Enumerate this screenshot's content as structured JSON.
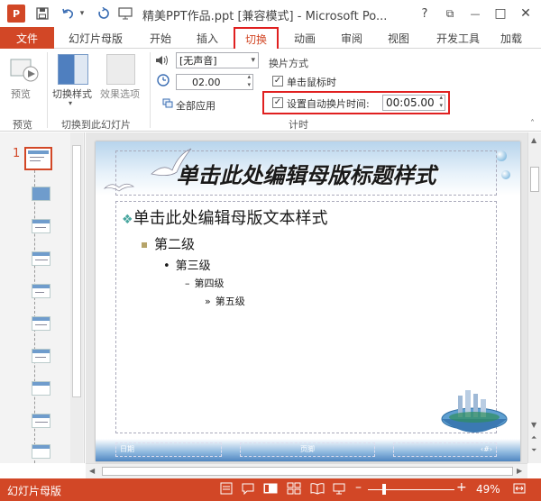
{
  "title_bar": {
    "app_badge": "P",
    "doc_title": "精美PPT作品.ppt [兼容模式] - Microsoft Po...",
    "help": "?",
    "restore": "⧉",
    "minimize": "—",
    "maximize": "□",
    "close": "✕"
  },
  "tabs": {
    "file": "文件",
    "items": [
      "幻灯片母版",
      "开始",
      "插入",
      "切换",
      "动画",
      "审阅",
      "视图",
      "开发工具",
      "加载"
    ]
  },
  "ribbon": {
    "preview_btn": "预览",
    "preview_group": "预览",
    "switch_style": "切换样式",
    "effect_options": "效果选项",
    "switch_group": "切换到此幻灯片",
    "sound_value": "[无声音]",
    "duration_value": "02.00",
    "apply_all": "全部应用",
    "slide_change_header": "换片方式",
    "on_click": "单击鼠标时",
    "on_click_checked": true,
    "auto_after": "设置自动换片时间:",
    "auto_after_checked": true,
    "auto_time": "00:05.00",
    "timing_group": "计时"
  },
  "thumbnails": {
    "current_number": "1",
    "count": 11
  },
  "slide": {
    "title": "单击此处编辑母版标题样式",
    "level1": "单击此处编辑母版文本样式",
    "level2": "第二级",
    "level3": "第三级",
    "level4": "第四级",
    "level5": "第五级",
    "footer_date": "日期",
    "footer_text": "页脚",
    "footer_num": "‹#›"
  },
  "status_bar": {
    "view_name": "幻灯片母版",
    "zoom": "49%"
  },
  "colors": {
    "accent": "#d24726",
    "highlight_border": "#e02020"
  }
}
